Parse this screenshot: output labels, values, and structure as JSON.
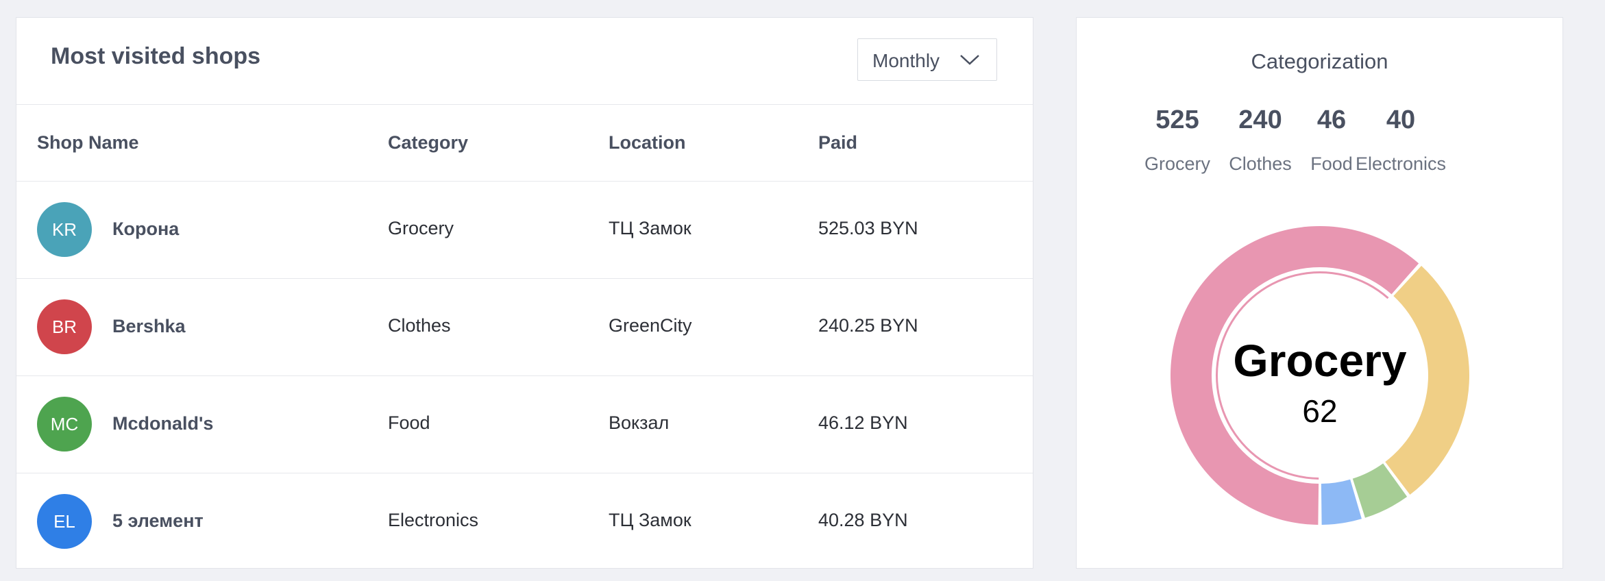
{
  "shops_card": {
    "title": "Most visited shops",
    "period_select": {
      "selected": "Monthly"
    },
    "columns": [
      "Shop Name",
      "Category",
      "Location",
      "Paid"
    ],
    "rows": [
      {
        "initials": "KR",
        "avatar_color": "#4aa3b8",
        "name": "Корона",
        "category": "Grocery",
        "location": "ТЦ Замок",
        "paid": "525.03 BYN"
      },
      {
        "initials": "BR",
        "avatar_color": "#d0454c",
        "name": "Bershka",
        "category": "Clothes",
        "location": "GreenCity",
        "paid": "240.25 BYN"
      },
      {
        "initials": "MC",
        "avatar_color": "#4ea44f",
        "name": "Mcdonald's",
        "category": "Food",
        "location": "Вокзал",
        "paid": "46.12 BYN"
      },
      {
        "initials": "EL",
        "avatar_color": "#2f7fe6",
        "name": "5 элемент",
        "category": "Electronics",
        "location": "ТЦ Замок",
        "paid": "40.28 BYN"
      }
    ]
  },
  "categorization": {
    "title": "Categorization",
    "stats": [
      {
        "value": "525",
        "label": "Grocery"
      },
      {
        "value": "240",
        "label": "Clothes"
      },
      {
        "value": "46",
        "label": "Food"
      },
      {
        "value": "40",
        "label": "Electronics"
      }
    ],
    "donut": {
      "center_label": "Grocery",
      "center_value": "62",
      "active_segment": "Grocery",
      "colors": {
        "Grocery": "#e896b1",
        "Clothes": "#f0cf86",
        "Food": "#a6cd95",
        "Electronics": "#8db9f5"
      }
    }
  },
  "chart_data": {
    "type": "pie",
    "categories": [
      "Grocery",
      "Clothes",
      "Food",
      "Electronics"
    ],
    "values": [
      525,
      240,
      46,
      40
    ],
    "title": "Categorization"
  }
}
